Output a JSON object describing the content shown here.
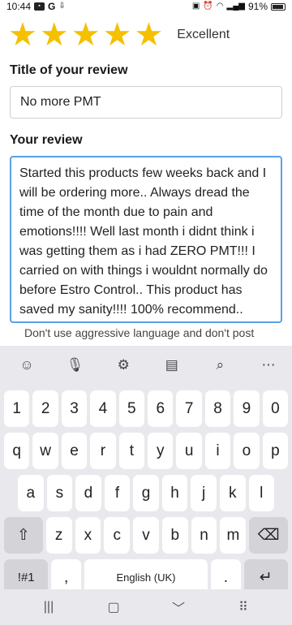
{
  "status_bar": {
    "time": "10:44",
    "battery": "91%"
  },
  "rating": {
    "stars": 5,
    "max_stars": 5,
    "label": "Excellent",
    "star_color": "#f5c000"
  },
  "title_section": {
    "label": "Title of your review",
    "value": "No more PMT"
  },
  "review_section": {
    "label": "Your review",
    "value": "Started this products few weeks back and I will be ordering more.. Always dread the time of the month due to pain and emotions!!!! Well last month i didnt think i was getting them as i had ZERO PMT!!! I carried on with things i wouldnt normally do before Estro Control.. This product has saved my sanity!!!! 100% recommend..",
    "focus_color": "#5aa0e8",
    "hint": "Don't use aggressive language and don't post"
  },
  "keyboard": {
    "toolbar_icons": [
      "emoji-icon",
      "mic-icon",
      "settings-icon",
      "clipboard-icon",
      "search-icon",
      "more-icon"
    ],
    "number_row": [
      "1",
      "2",
      "3",
      "4",
      "5",
      "6",
      "7",
      "8",
      "9",
      "0"
    ],
    "row1": [
      "q",
      "w",
      "e",
      "r",
      "t",
      "y",
      "u",
      "i",
      "o",
      "p"
    ],
    "row2": [
      "a",
      "s",
      "d",
      "f",
      "g",
      "h",
      "j",
      "k",
      "l"
    ],
    "row3": [
      "z",
      "x",
      "c",
      "v",
      "b",
      "n",
      "m"
    ],
    "symbols_label": "!#1",
    "comma": ",",
    "space_label": "English (UK)",
    "period": "."
  },
  "navbar": {
    "icons": [
      "recents-icon",
      "home-icon",
      "back-icon",
      "keyboard-switch-icon"
    ]
  }
}
